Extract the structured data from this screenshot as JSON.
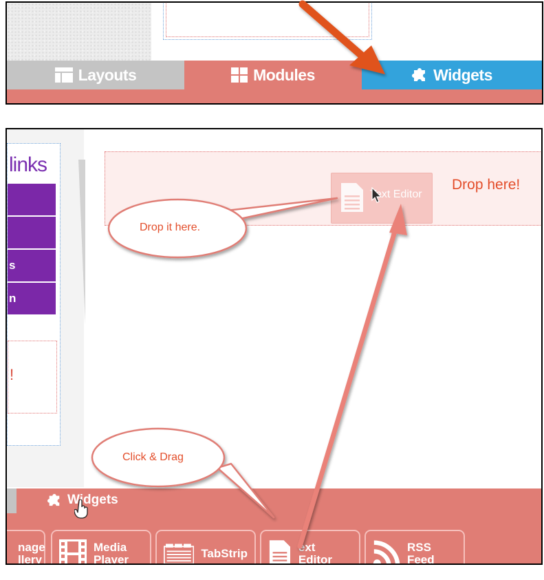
{
  "panel1": {
    "tabs": [
      {
        "label": "Layouts",
        "icon": "layout-icon"
      },
      {
        "label": "Modules",
        "icon": "grid-icon"
      },
      {
        "label": "Widgets",
        "icon": "puzzle-icon"
      }
    ]
  },
  "panel2": {
    "sidebar": {
      "title": "links",
      "rows": [
        "",
        "",
        "s",
        "n"
      ],
      "red_text": "!"
    },
    "drop_zone": {
      "label": "Drop here!",
      "ghost_label": "Text Editor"
    },
    "bottom_bar": {
      "tab_label": "Widgets",
      "widgets": [
        {
          "line1": "nage",
          "line2": "llery",
          "icon": "image-gallery-icon"
        },
        {
          "line1": "Media",
          "line2": "Player",
          "icon": "film-icon"
        },
        {
          "line1": "TabStrip",
          "line2": "",
          "icon": "tabstrip-icon"
        },
        {
          "line1": "ext Editor",
          "line2": "",
          "icon": "document-icon"
        },
        {
          "line1": "RSS Feed",
          "line2": "",
          "icon": "rss-icon"
        }
      ]
    },
    "callouts": {
      "drop": "Drop it here.",
      "drag": "Click & Drag"
    }
  },
  "colors": {
    "salmon": "#e07d75",
    "blue": "#33a3dc",
    "gray": "#c4c4c4",
    "purple": "#7b28a8",
    "accent_red": "#e34e2b"
  }
}
